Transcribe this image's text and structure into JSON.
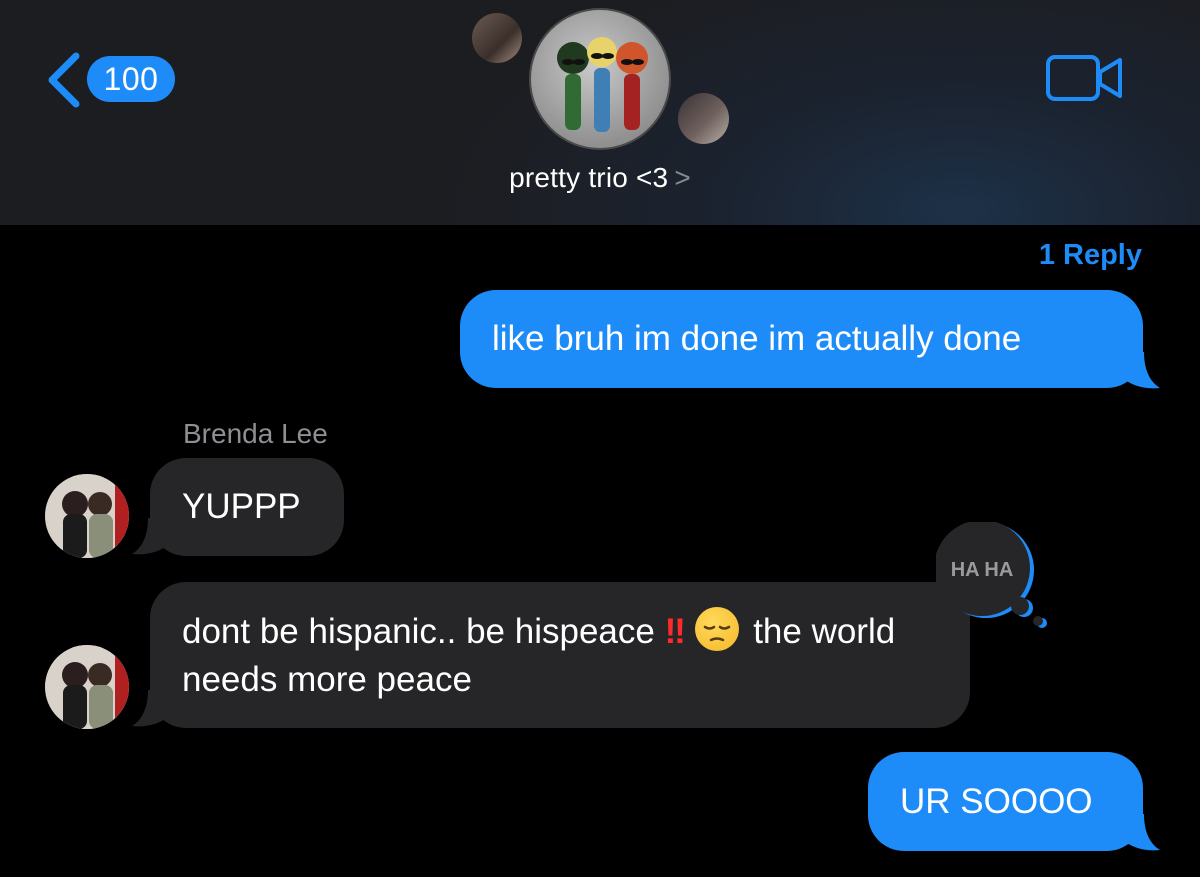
{
  "header": {
    "back_count": "100",
    "group_name": "pretty trio <3",
    "title_chevron": ">"
  },
  "thread": {
    "reply_link": "1 Reply",
    "messages": [
      {
        "direction": "outgoing",
        "text": "like bruh im done im actually done"
      },
      {
        "direction": "incoming",
        "sender": "Brenda Lee",
        "text": "YUPPP"
      },
      {
        "direction": "incoming",
        "text_before": "dont be hispanic.. be hispeace",
        "emoji_1": "‼",
        "emoji_2_name": "pensive-face",
        "text_after": "the world needs more peace",
        "tapback": "HA HA"
      },
      {
        "direction": "outgoing",
        "text": "UR SOOOO"
      }
    ]
  },
  "colors": {
    "accent_blue": "#1e8cf8",
    "incoming_bubble": "#262628",
    "header_bg": "#1c1d21"
  },
  "icons": [
    "back-chevron-icon",
    "video-camera-icon",
    "haha-tapback-icon",
    "pensive-face-icon"
  ]
}
